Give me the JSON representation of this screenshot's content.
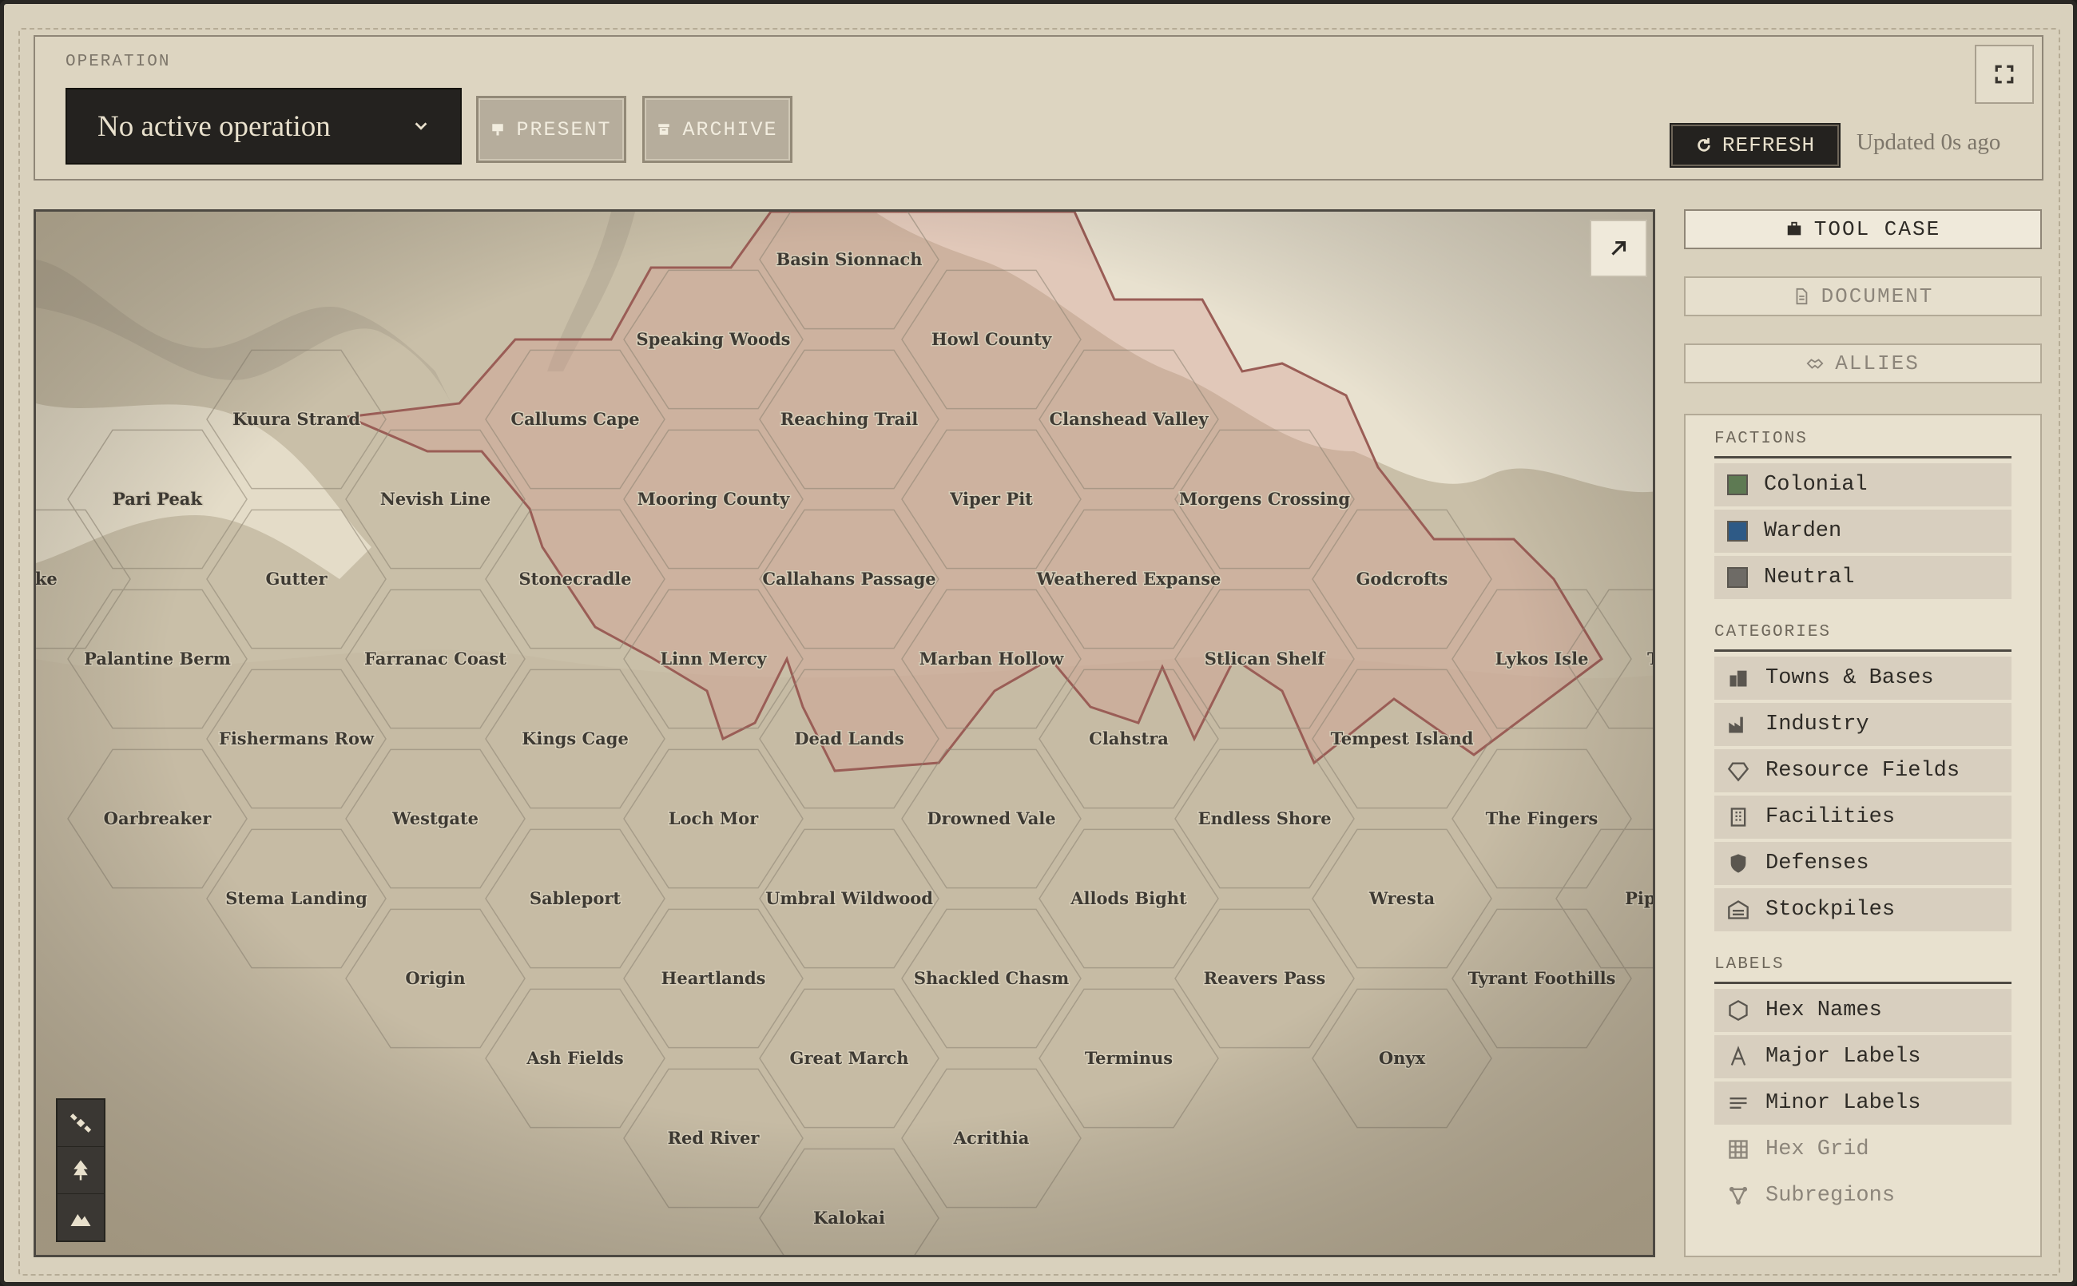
{
  "topbar": {
    "operation_label": "OPERATION",
    "operation_value": "No active operation",
    "present_label": "PRESENT",
    "archive_label": "ARCHIVE",
    "refresh_label": "REFRESH",
    "updated_text": "Updated 0s ago"
  },
  "sidebar": {
    "tool_case_label": "TOOL CASE",
    "document_label": "DOCUMENT",
    "allies_label": "ALLIES",
    "factions_heading": "FACTIONS",
    "factions": [
      {
        "label": "Colonial",
        "color": "#5e7a53"
      },
      {
        "label": "Warden",
        "color": "#2e5a86"
      },
      {
        "label": "Neutral",
        "color": "#6e6b66"
      }
    ],
    "categories_heading": "CATEGORIES",
    "categories": [
      {
        "label": "Towns & Bases",
        "icon": "buildings-icon"
      },
      {
        "label": "Industry",
        "icon": "factory-icon"
      },
      {
        "label": "Resource Fields",
        "icon": "gem-icon"
      },
      {
        "label": "Facilities",
        "icon": "grid-building-icon"
      },
      {
        "label": "Defenses",
        "icon": "shield-icon"
      },
      {
        "label": "Stockpiles",
        "icon": "warehouse-icon"
      }
    ],
    "labels_heading": "LABELS",
    "labels": [
      {
        "label": "Hex Names",
        "icon": "hexagon-icon",
        "active": true
      },
      {
        "label": "Major Labels",
        "icon": "letter-a-icon",
        "active": true
      },
      {
        "label": "Minor Labels",
        "icon": "lines-icon",
        "active": true
      },
      {
        "label": "Hex Grid",
        "icon": "grid-icon",
        "active": false
      },
      {
        "label": "Subregions",
        "icon": "nodes-icon",
        "active": false
      }
    ]
  },
  "map": {
    "hex_names": [
      "Basin Sionnach",
      "Speaking Woods",
      "Howl County",
      "Kuura Strand",
      "Callums Cape",
      "Reaching Trail",
      "Clanshead Valley",
      "Pari Peak",
      "Nevish Line",
      "Mooring County",
      "Viper Pit",
      "Morgens Crossing",
      "ake",
      "Gutter",
      "Stonecradle",
      "Callahans Passage",
      "Weathered Expanse",
      "Godcrofts",
      "Palantine Berm",
      "Farranac Coast",
      "Linn Mercy",
      "Marban Hollow",
      "Stlican Shelf",
      "Lykos Isle",
      "T",
      "Fishermans Row",
      "Kings Cage",
      "Dead Lands",
      "Clahstra",
      "Tempest Island",
      "Oarbreaker",
      "Westgate",
      "Loch Mor",
      "Drowned Vale",
      "Endless Shore",
      "The Fingers",
      "Stema Landing",
      "Sableport",
      "Umbral Wildwood",
      "Allods Bight",
      "Wresta",
      "Pipe",
      "Origin",
      "Heartlands",
      "Shackled Chasm",
      "Reavers Pass",
      "Tyrant Foothills",
      "Ash Fields",
      "Great March",
      "Terminus",
      "Onyx",
      "Red River",
      "Acrithia",
      "Kalokai"
    ]
  }
}
